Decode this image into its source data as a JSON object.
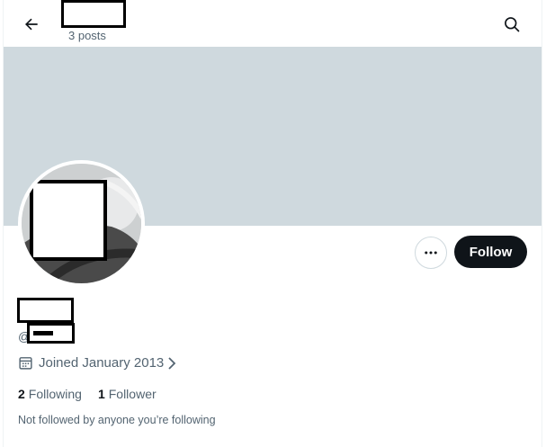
{
  "header": {
    "back_icon": "arrow-left-icon",
    "post_count": "3 posts",
    "search_icon": "search-icon"
  },
  "profile": {
    "handle_prefix": "@",
    "joined": "Joined January 2013",
    "more_icon": "more-horizontal-icon",
    "follow_label": "Follow",
    "following_count": "2",
    "following_label": "Following",
    "followers_count": "1",
    "followers_label": "Follower",
    "social_context": "Not followed by anyone you’re following"
  },
  "colors": {
    "banner": "#cfd9de",
    "follow_button": "#0f1419",
    "secondary_text": "#536471"
  }
}
